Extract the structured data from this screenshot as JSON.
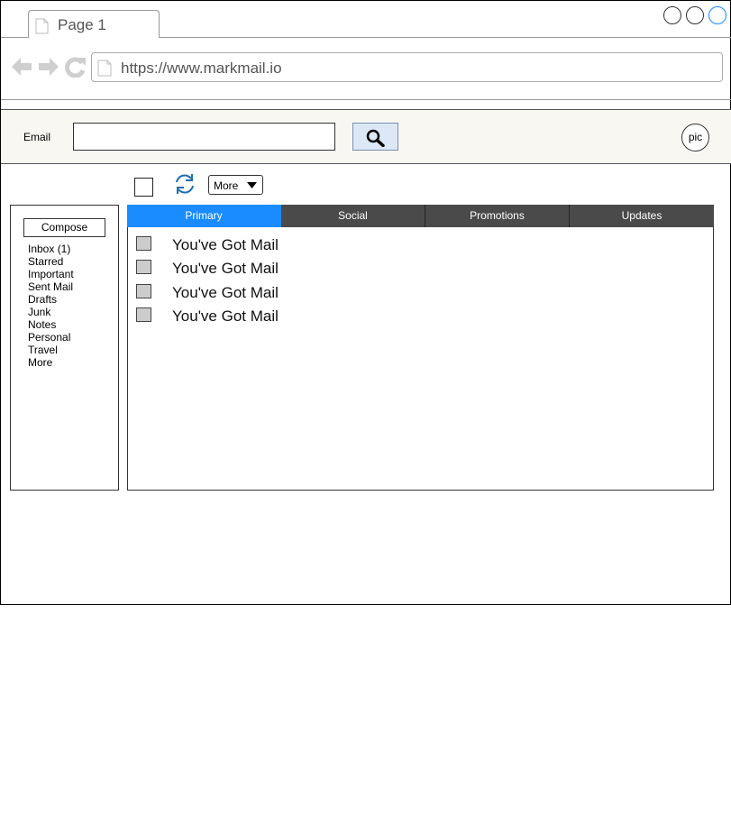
{
  "browser": {
    "tab_label": "Page 1",
    "url": "https://www.markmail.io",
    "window_controls": [
      "minimize-circle",
      "maximize-circle",
      "close-circle"
    ],
    "accent_color": "#1a8cff"
  },
  "header": {
    "email_label": "Email",
    "email_value": "",
    "search_icon": "search-icon",
    "avatar_label": "pic"
  },
  "toolbar": {
    "refresh_icon": "refresh-icon",
    "more_label": "More"
  },
  "sidebar": {
    "compose_label": "Compose",
    "folders": [
      "Inbox (1)",
      "Starred",
      "Important",
      "Sent Mail",
      "Drafts",
      "Junk",
      "Notes",
      "Personal",
      "Travel",
      "More"
    ]
  },
  "main": {
    "tabs": [
      {
        "label": "Primary",
        "active": true
      },
      {
        "label": "Social",
        "active": false
      },
      {
        "label": "Promotions",
        "active": false
      },
      {
        "label": "Updates",
        "active": false
      }
    ],
    "messages": [
      {
        "subject": "You've Got Mail"
      },
      {
        "subject": "You've Got Mail"
      },
      {
        "subject": "You've Got Mail"
      },
      {
        "subject": "You've Got Mail"
      }
    ]
  }
}
